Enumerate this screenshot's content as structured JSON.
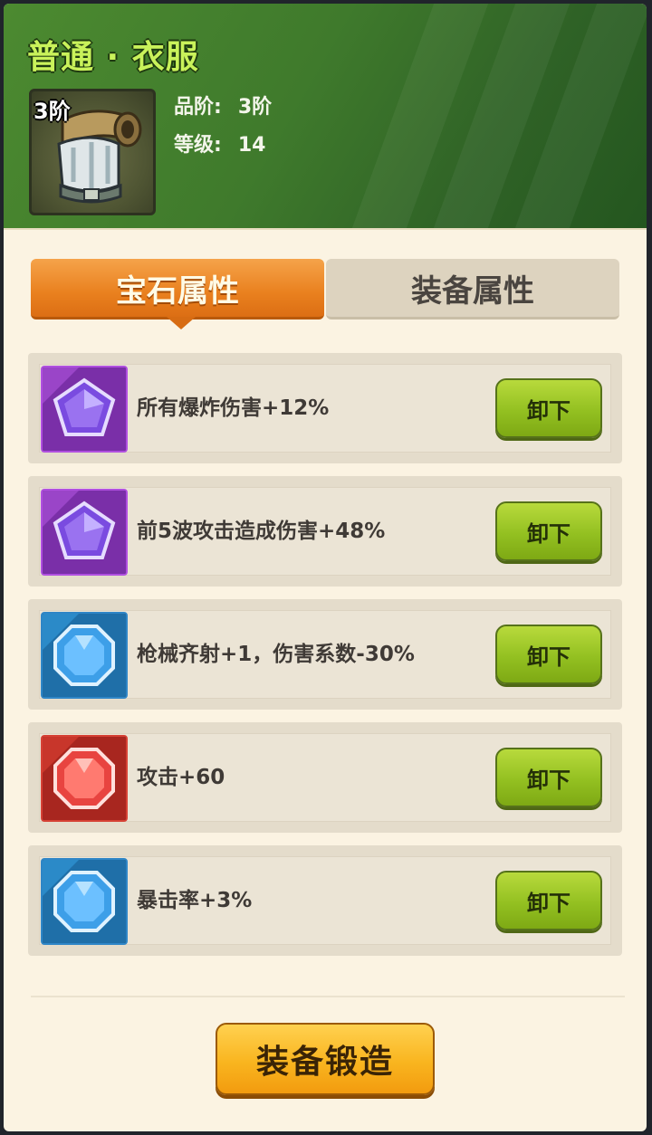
{
  "header": {
    "title": "普通 · 衣服",
    "tier_badge": "3阶",
    "item_icon": "armor-vest-icon",
    "quality_label": "品阶:",
    "quality_value": "3阶",
    "level_label": "等级:",
    "level_value": "14"
  },
  "tabs": [
    {
      "label": "宝石属性",
      "active": true
    },
    {
      "label": "装备属性",
      "active": false
    }
  ],
  "gems": [
    {
      "color": "purple",
      "icon": "purple-pentagon-gem-icon",
      "text": "所有爆炸伤害+12%",
      "button": "卸下"
    },
    {
      "color": "purple",
      "icon": "purple-pentagon-gem-icon",
      "text": "前5波攻击造成伤害+48%",
      "button": "卸下"
    },
    {
      "color": "blue",
      "icon": "blue-octagon-gem-icon",
      "text": "枪械齐射+1，伤害系数-30%",
      "button": "卸下"
    },
    {
      "color": "red",
      "icon": "red-octagon-gem-icon",
      "text": "攻击+60",
      "button": "卸下"
    },
    {
      "color": "blue",
      "icon": "blue-octagon-gem-icon",
      "text": "暴击率+3%",
      "button": "卸下"
    }
  ],
  "forge_button": "装备锻造",
  "colors": {
    "header_green": "#3f7a2c",
    "title_lime": "#c9f25a",
    "tab_orange": "#e9801e",
    "button_green": "#93c021",
    "forge_yellow": "#f9b51f",
    "panel_bg": "#fbf3e2"
  }
}
